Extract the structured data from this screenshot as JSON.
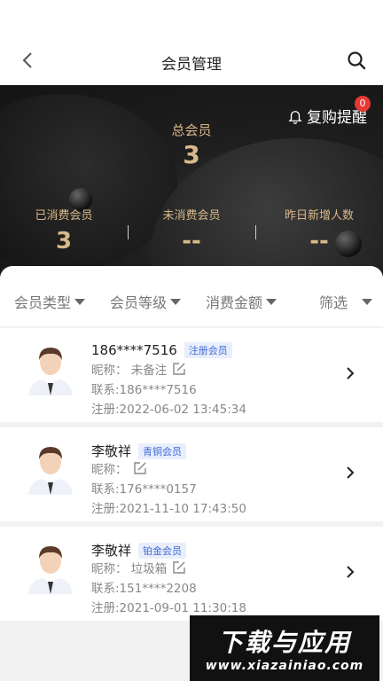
{
  "header": {
    "title": "会员管理"
  },
  "hero": {
    "total_label": "总会员",
    "total_value": "3",
    "remind_label": "复购提醒",
    "remind_badge": "0",
    "stats": [
      {
        "label": "已消费会员",
        "value": "3"
      },
      {
        "label": "未消费会员",
        "value": "--"
      },
      {
        "label": "昨日新增人数",
        "value": "--"
      }
    ]
  },
  "filters": [
    {
      "label": "会员类型"
    },
    {
      "label": "会员等级"
    },
    {
      "label": "消费金额"
    },
    {
      "label": "筛选"
    }
  ],
  "members": [
    {
      "name": "186****7516",
      "tag": "注册会员",
      "nickname": "昵称：  未备注",
      "contact": "联系:186****7516",
      "registered": "注册:2022-06-02 13:45:34"
    },
    {
      "name": "李敬祥",
      "tag": "青铜会员",
      "nickname": "昵称：",
      "contact": "联系:176****0157",
      "registered": "注册:2021-11-10 17:43:50"
    },
    {
      "name": "李敬祥",
      "tag": "铂金会员",
      "nickname": "昵称：  垃圾箱",
      "contact": "联系:151****2208",
      "registered": "注册:2021-09-01 11:30:18"
    }
  ],
  "watermark": {
    "line1": "下载与应用",
    "line2": "www.xiazainiao.com"
  },
  "colors": {
    "gold": "#d8b98a",
    "tag_blue": "#3f6ad8",
    "badge_red": "#e53935"
  }
}
